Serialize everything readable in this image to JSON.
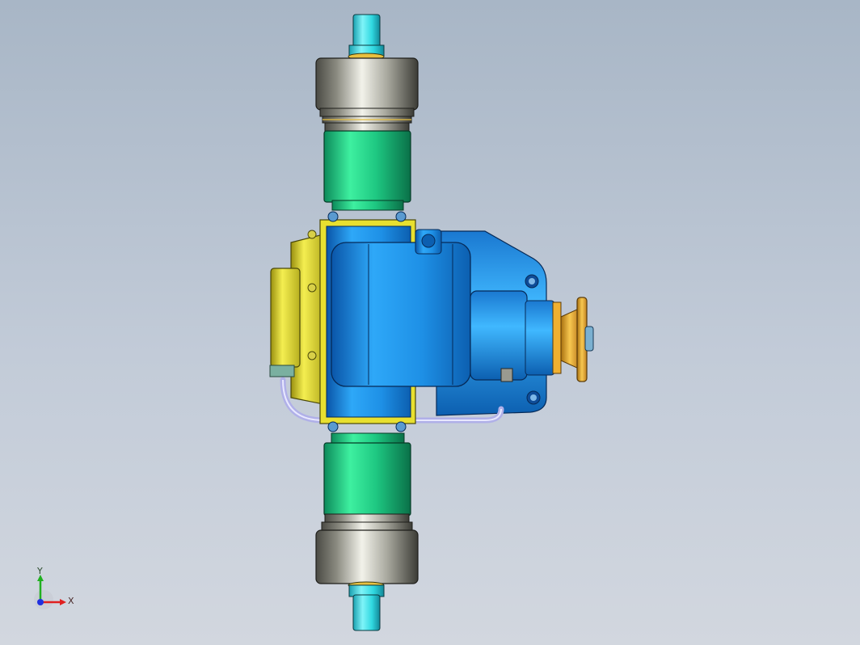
{
  "viewport": {
    "background_top": "#a8b6c6",
    "background_bottom": "#d2d7df"
  },
  "model": {
    "colors": {
      "housing_blue": "#1e90e6",
      "housing_dark": "#0c5fb0",
      "cover_yellow": "#e8e030",
      "coupling_green": "#1ec882",
      "bearing_gray": "#9a9a90",
      "shaft_cyan": "#30d8e0",
      "flange_orange": "#f0b030",
      "pipe_lilac": "#b0b0e8"
    },
    "parts": [
      "upper-shaft",
      "upper-bearing",
      "upper-coupling",
      "gearbox-housing",
      "side-cover",
      "output-flange",
      "lower-coupling",
      "lower-bearing",
      "lower-shaft",
      "lube-pipe"
    ]
  },
  "triad": {
    "x_label": "X",
    "y_label": "Y",
    "x_color": "#e02020",
    "y_color": "#20b020",
    "z_color": "#2030e0"
  }
}
